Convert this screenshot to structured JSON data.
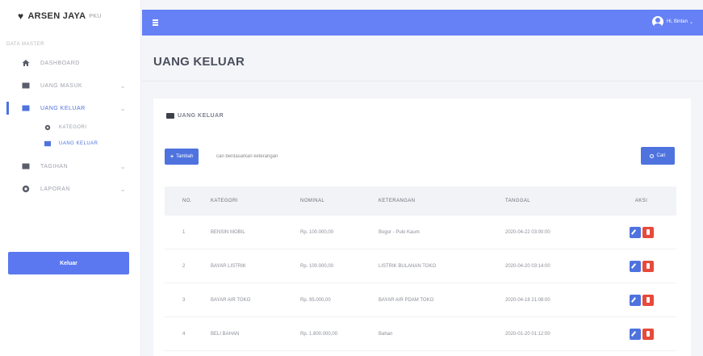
{
  "brand": {
    "name": "ARSEN JAYA",
    "suffix": "PKU"
  },
  "sidebar": {
    "section_label": "DATA MASTER",
    "items": [
      {
        "label": "DASHBOARD",
        "icon": "home-icon"
      },
      {
        "label": "UANG MASUK",
        "icon": "folder-icon"
      },
      {
        "label": "UANG KELUAR",
        "icon": "folder-icon",
        "active": true
      },
      {
        "label": "TAGIHAN",
        "icon": "folder-icon"
      },
      {
        "label": "LAPORAN",
        "icon": "gear-icon"
      }
    ],
    "sub_items": [
      {
        "label": "KATEGORI",
        "icon": "gear-icon"
      },
      {
        "label": "UANG KELUAR",
        "icon": "table-icon",
        "active": true
      }
    ],
    "logout_label": "Keluar"
  },
  "topbar": {
    "user_label": "Hi, Bintan"
  },
  "page": {
    "title": "UANG KELUAR",
    "card_title": "UANG KELUAR",
    "add_label": "Tambah",
    "search_placeholder": "cari berdasarkan keterangan",
    "search_label": "Cari"
  },
  "table": {
    "headers": [
      "NO.",
      "KATEGORI",
      "NOMINAL",
      "KETERANGAN",
      "TANGGAL",
      "AKSI"
    ],
    "rows": [
      [
        "1",
        "BENSIN MOBIL",
        "Rp. 100.000,00",
        "Bogor - Pulo Kaum",
        "2020-04-22 03:00:00"
      ],
      [
        "2",
        "BAYAR LISTRIK",
        "Rp. 100.000,00",
        "LISTRIK BULANAN TOKO",
        "2020-04-20 03:14:00"
      ],
      [
        "3",
        "BAYAR AIR TOKO",
        "Rp. 95.000,00",
        "BAYAR AIR PDAM TOKO",
        "2020-04-18 21:08:00"
      ],
      [
        "4",
        "BELI BAHAN",
        "Rp. 1.800.000,00",
        "Bahan",
        "2020-01-20 01:12:00"
      ]
    ]
  },
  "colors": {
    "accent": "#4e73df",
    "topbar": "#6680f5",
    "danger": "#e74a3b"
  }
}
